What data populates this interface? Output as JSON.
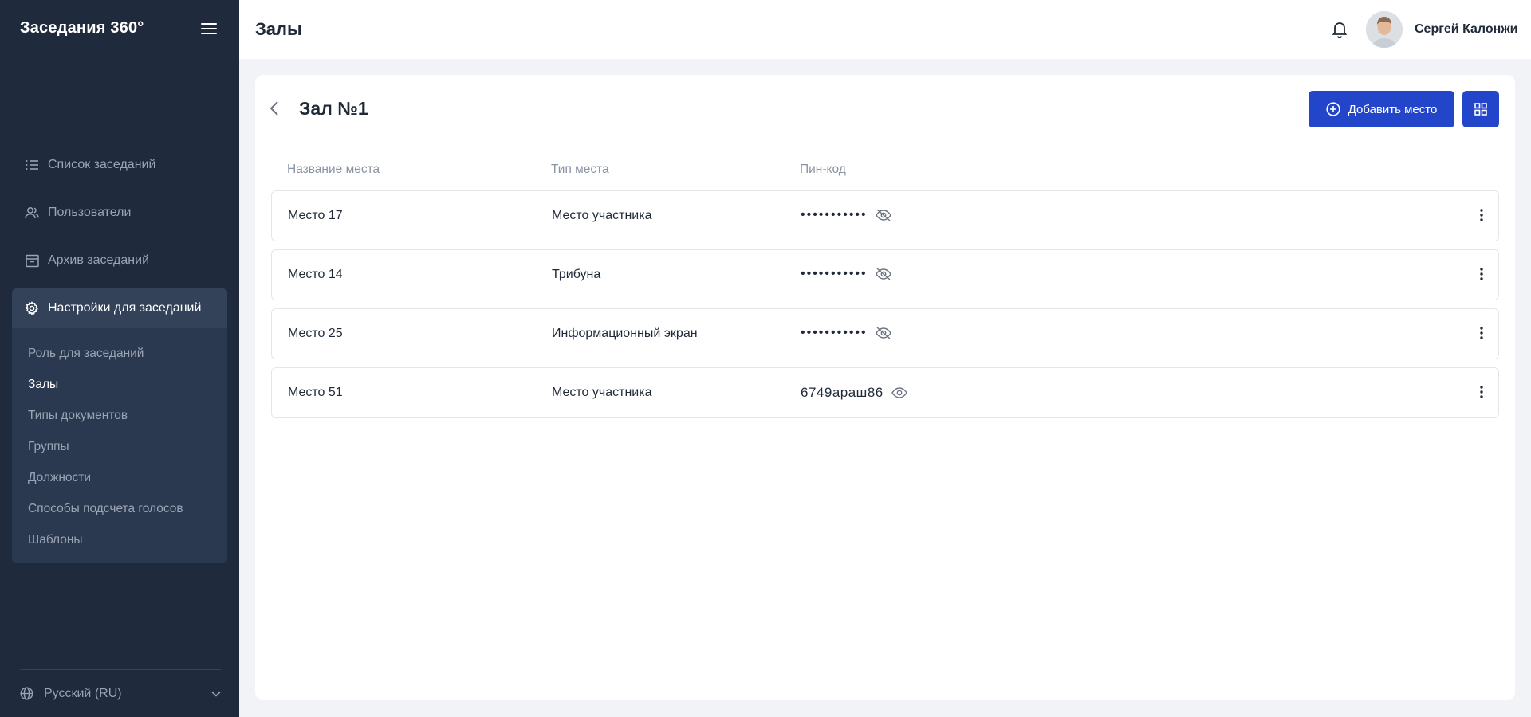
{
  "sidebar": {
    "brand": "Заседания 360°",
    "items": [
      {
        "label": "Список заседаний",
        "icon": "list-icon"
      },
      {
        "label": "Пользователи",
        "icon": "users-icon"
      },
      {
        "label": "Архив заседаний",
        "icon": "archive-icon"
      }
    ],
    "group": {
      "label": "Настройки для заседаний",
      "icon": "gear-icon",
      "children": [
        {
          "label": "Роль для заседаний",
          "active": false
        },
        {
          "label": "Залы",
          "active": true
        },
        {
          "label": "Типы документов",
          "active": false
        },
        {
          "label": "Группы",
          "active": false
        },
        {
          "label": "Должности",
          "active": false
        },
        {
          "label": "Способы подсчета голосов",
          "active": false
        },
        {
          "label": "Шаблоны",
          "active": false
        }
      ]
    },
    "language": "Русский (RU)"
  },
  "header": {
    "title": "Залы",
    "user_name": "Сергей Калонжи"
  },
  "hall": {
    "title": "Зал №1",
    "add_button": "Добавить место",
    "columns": [
      "Название места",
      "Тип места",
      "Пин-код"
    ],
    "rows": [
      {
        "name": "Место 17",
        "type": "Место участника",
        "pin": "•••••••••••",
        "pin_visible": false
      },
      {
        "name": "Место 14",
        "type": "Трибуна",
        "pin": "•••••••••••",
        "pin_visible": false
      },
      {
        "name": "Место 25",
        "type": "Информационный экран",
        "pin": "•••••••••••",
        "pin_visible": false
      },
      {
        "name": "Место 51",
        "type": "Место участника",
        "pin": "6749араш86",
        "pin_visible": true
      }
    ]
  },
  "colors": {
    "sidebar_bg": "#1f2a3c",
    "accent": "#2345c9"
  }
}
